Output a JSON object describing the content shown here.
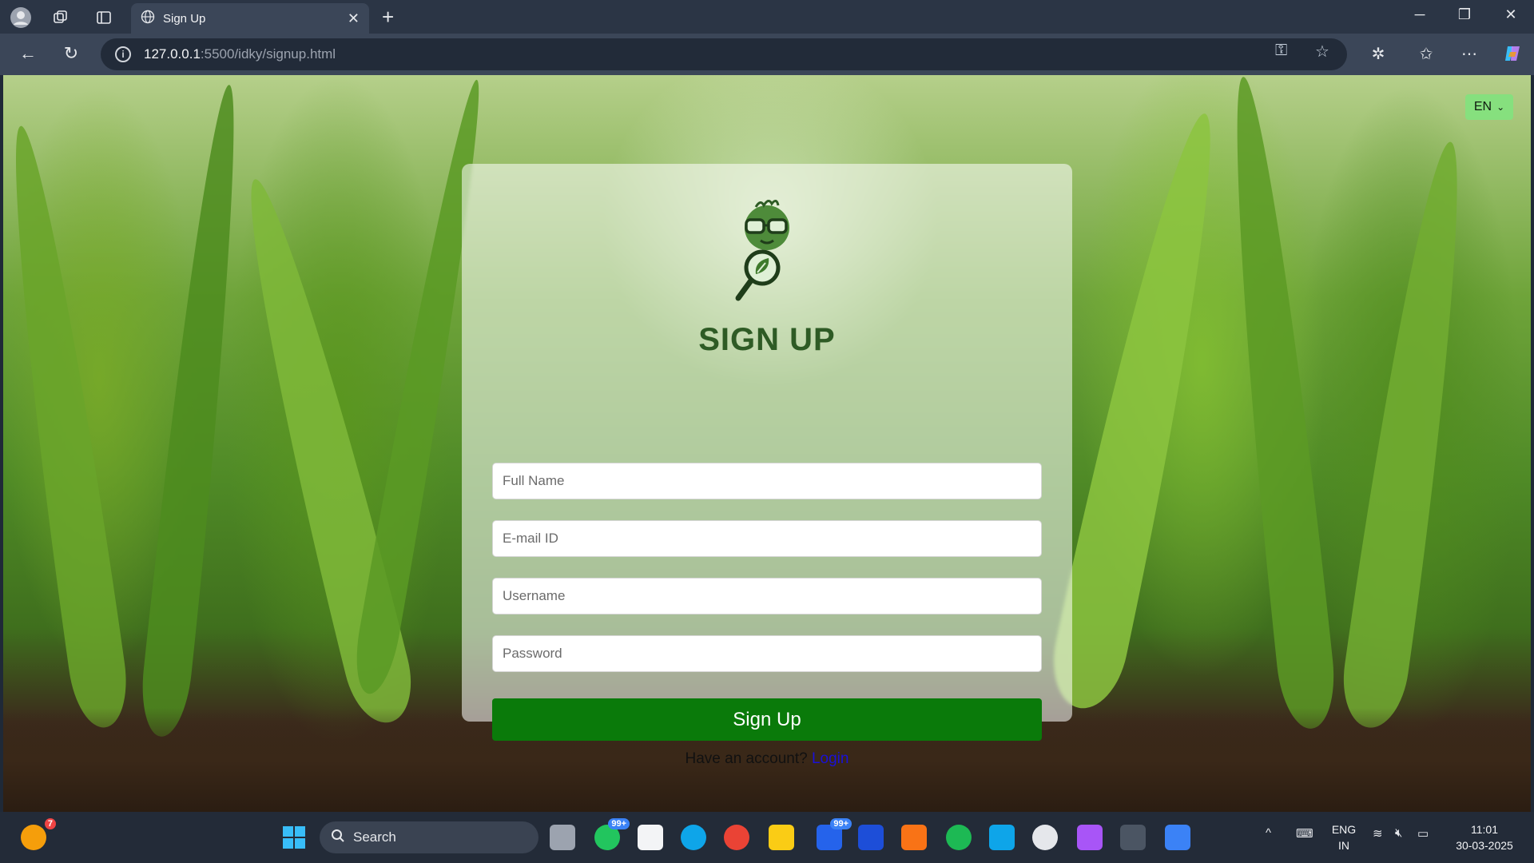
{
  "browser": {
    "tab_title": "Sign Up",
    "url_host": "127.0.0.1",
    "url_path": ":5500/idky/signup.html"
  },
  "page": {
    "language": "EN",
    "heading": "SIGN UP",
    "fields": {
      "full_name_placeholder": "Full Name",
      "email_placeholder": "E-mail ID",
      "username_placeholder": "Username",
      "password_placeholder": "Password"
    },
    "submit_label": "Sign Up",
    "account_prompt": "Have an account?",
    "login_link": "Login"
  },
  "taskbar": {
    "search_label": "Search",
    "notification_count": "7",
    "whatsapp_badge": "99+",
    "mail_badge": "99+",
    "lang_line1": "ENG",
    "lang_line2": "IN",
    "time": "11:01",
    "date": "30-03-2025"
  },
  "colors": {
    "accent_green": "#0a7a0a",
    "heading_green": "#2e5b25",
    "lang_badge": "#86e07e",
    "link_blue": "#1a10d8"
  }
}
